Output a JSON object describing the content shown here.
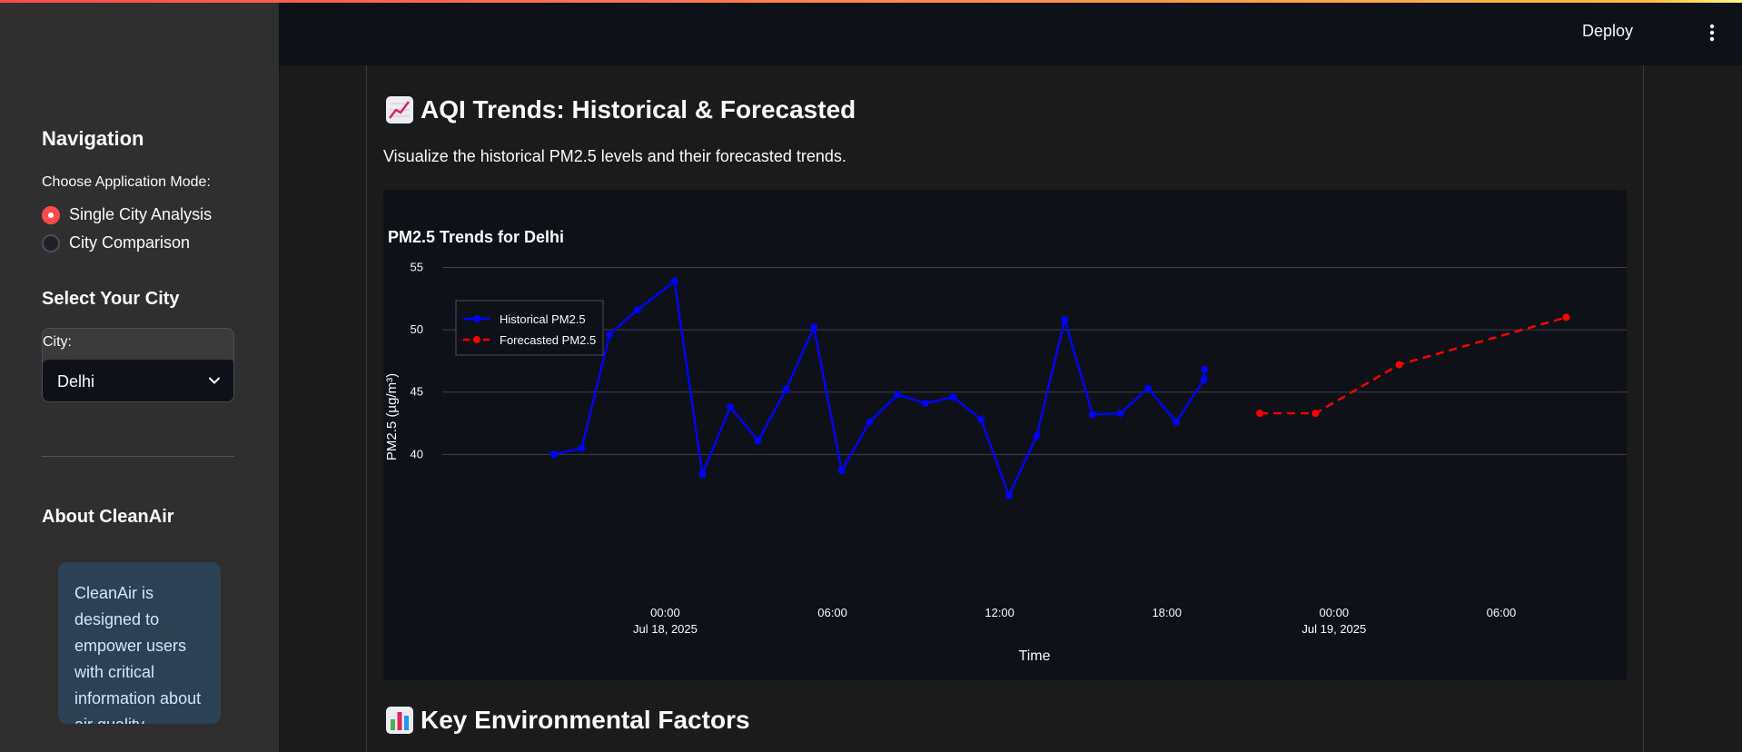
{
  "sidebar": {
    "nav_title": "Navigation",
    "mode_label": "Choose Application Mode:",
    "modes": [
      {
        "label": "Single City Analysis",
        "selected": true
      },
      {
        "label": "City Comparison",
        "selected": false
      }
    ],
    "city_title": "Select Your City",
    "city_label": "City:",
    "city_value": "Delhi",
    "about_title": "About CleanAir",
    "about_text": "CleanAir is designed to empower users with critical information about air quality"
  },
  "header": {
    "deploy_label": "Deploy",
    "menu_icon": "kebab-menu-icon"
  },
  "main": {
    "trends_title": "AQI Trends: Historical & Forecasted",
    "trends_icon": "chart-increasing-icon",
    "trends_desc": "Visualize the historical PM2.5 levels and their forecasted trends.",
    "factors_title": "Key Environmental Factors",
    "factors_icon": "bar-chart-icon"
  },
  "colors": {
    "accent": "#ff4b4b",
    "historical": "#0000ff",
    "forecast": "#ff0000"
  },
  "chart_data": {
    "type": "line",
    "title": "PM2.5 Trends for Delhi",
    "xlabel": "Time",
    "ylabel": "PM2.5 (µg/m³)",
    "ylim": [
      35,
      57
    ],
    "yticks": [
      40,
      45,
      50,
      55
    ],
    "xticks": [
      {
        "t": "2025-07-18T00:00",
        "line1": "00:00",
        "line2": "Jul 18, 2025"
      },
      {
        "t": "2025-07-18T06:00",
        "line1": "06:00",
        "line2": ""
      },
      {
        "t": "2025-07-18T12:00",
        "line1": "12:00",
        "line2": ""
      },
      {
        "t": "2025-07-18T18:00",
        "line1": "18:00",
        "line2": ""
      },
      {
        "t": "2025-07-19T00:00",
        "line1": "00:00",
        "line2": "Jul 19, 2025"
      },
      {
        "t": "2025-07-19T06:00",
        "line1": "06:00",
        "line2": ""
      }
    ],
    "xrange": [
      "2025-07-17T16:00",
      "2025-07-19T10:30"
    ],
    "legend_position": "top-left",
    "grid": true,
    "series": [
      {
        "name": "Historical PM2.5",
        "style": "solid",
        "x": [
          "2025-07-17T20:00",
          "2025-07-17T21:00",
          "2025-07-17T22:00",
          "2025-07-17T23:00",
          "2025-07-18T00:20",
          "2025-07-18T01:20",
          "2025-07-18T02:20",
          "2025-07-18T03:20",
          "2025-07-18T04:20",
          "2025-07-18T05:20",
          "2025-07-18T06:20",
          "2025-07-18T07:20",
          "2025-07-18T08:20",
          "2025-07-18T09:20",
          "2025-07-18T10:20",
          "2025-07-18T11:20",
          "2025-07-18T12:20",
          "2025-07-18T13:20",
          "2025-07-18T14:20",
          "2025-07-18T15:20",
          "2025-07-18T16:20",
          "2025-07-18T17:20",
          "2025-07-18T18:20",
          "2025-07-18T19:20",
          "2025-07-18T19:21"
        ],
        "values": [
          40.0,
          40.5,
          49.6,
          51.6,
          53.9,
          38.4,
          43.8,
          41.1,
          45.2,
          50.2,
          38.7,
          42.6,
          44.8,
          44.1,
          44.6,
          42.8,
          36.7,
          41.5,
          50.8,
          43.2,
          43.3,
          45.3,
          42.6,
          46.0,
          46.8
        ]
      },
      {
        "name": "Forecasted PM2.5",
        "style": "dashed",
        "x": [
          "2025-07-18T21:20",
          "2025-07-18T23:20",
          "2025-07-19T02:20",
          "2025-07-19T08:20"
        ],
        "values": [
          43.3,
          43.3,
          47.2,
          51.0
        ]
      }
    ]
  }
}
